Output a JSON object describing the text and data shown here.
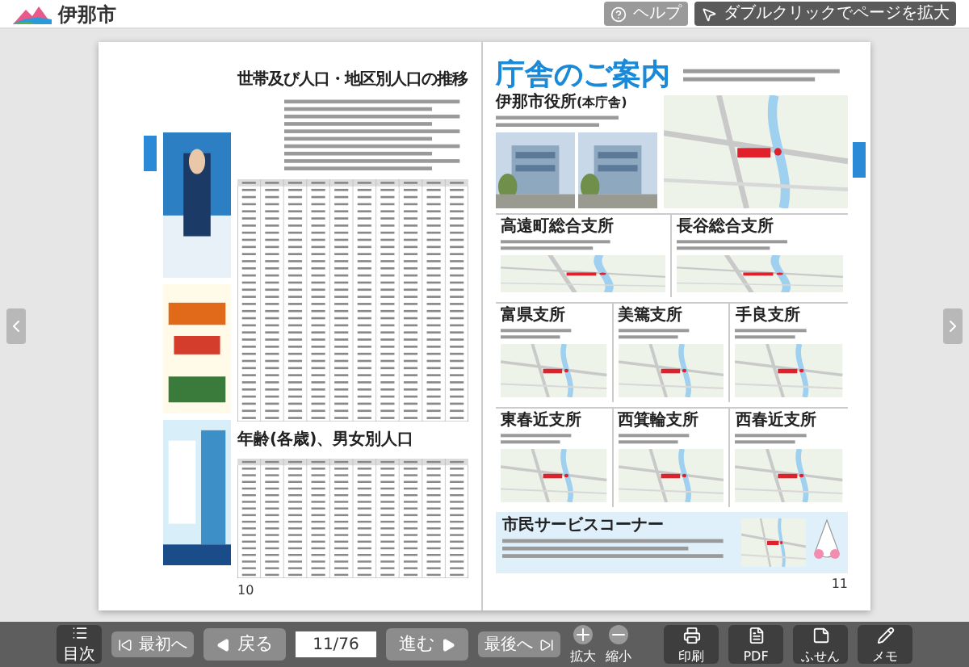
{
  "header": {
    "logo": "伊那市",
    "help": "ヘルプ",
    "zoom_hint": "ダブルクリックでページを拡大"
  },
  "left_page": {
    "title": "世帯及び人口・地区別人口の推移",
    "subtitle": "年齢(各歳)、男女別人口",
    "page_number": "10"
  },
  "right_page": {
    "title": "庁舎のご案内",
    "main_office": {
      "name": "伊那市役所",
      "note": "(本庁舎)"
    },
    "branch_rows": [
      [
        {
          "name": "高遠町総合支所"
        },
        {
          "name": "長谷総合支所"
        }
      ],
      [
        {
          "name": "富県支所"
        },
        {
          "name": "美篶支所"
        },
        {
          "name": "手良支所"
        }
      ],
      [
        {
          "name": "東春近支所"
        },
        {
          "name": "西箕輪支所"
        },
        {
          "name": "西春近支所"
        }
      ]
    ],
    "service_corner": {
      "name": "市民サービスコーナー"
    },
    "page_number": "11"
  },
  "toolbar": {
    "toc": "目次",
    "first": "最初へ",
    "prev": "戻る",
    "page": "11/76",
    "next": "進む",
    "last": "最後へ",
    "zoom_in": "拡大",
    "zoom_out": "縮小",
    "tools": [
      {
        "kind": "print",
        "label": "印刷"
      },
      {
        "kind": "pdf",
        "label": "PDF"
      },
      {
        "kind": "sticky",
        "label": "ふせん"
      },
      {
        "kind": "memo",
        "label": "メモ"
      }
    ]
  }
}
